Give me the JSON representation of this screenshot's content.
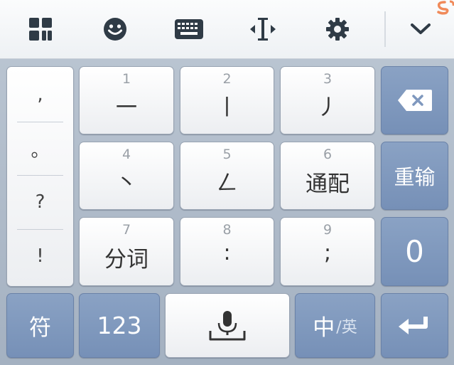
{
  "toolbar": {
    "icons": [
      "grid-menu-icon",
      "emoji-icon",
      "keyboard-icon",
      "cursor-move-icon",
      "settings-icon",
      "collapse-chevron-icon"
    ],
    "corner_logo": "sogou-logo"
  },
  "keyboard": {
    "punctuation": [
      ",",
      "。",
      "?",
      "!"
    ],
    "keys": [
      {
        "num": "1",
        "label": "一"
      },
      {
        "num": "2",
        "label": "丨"
      },
      {
        "num": "3",
        "label": "丿"
      },
      {
        "num": "4",
        "label": "丶"
      },
      {
        "num": "5",
        "label": "ㄥ"
      },
      {
        "num": "6",
        "label": "通配"
      },
      {
        "num": "7",
        "label": "分词"
      },
      {
        "num": "8",
        "label": ":"
      },
      {
        "num": "9",
        "label": ";"
      }
    ],
    "side": {
      "delete_icon": "backspace-icon",
      "reenter": "重输",
      "zero": "0"
    },
    "bottom": {
      "symbols": "符",
      "numbers": "123",
      "space_icon": "microphone-space-icon",
      "lang_main": "中",
      "lang_alt": "/英",
      "enter_icon": "enter-icon"
    }
  },
  "colors": {
    "accent_blue": "#7f98be",
    "key_white": "#f7f8fa",
    "background": "#aeb9c7"
  }
}
